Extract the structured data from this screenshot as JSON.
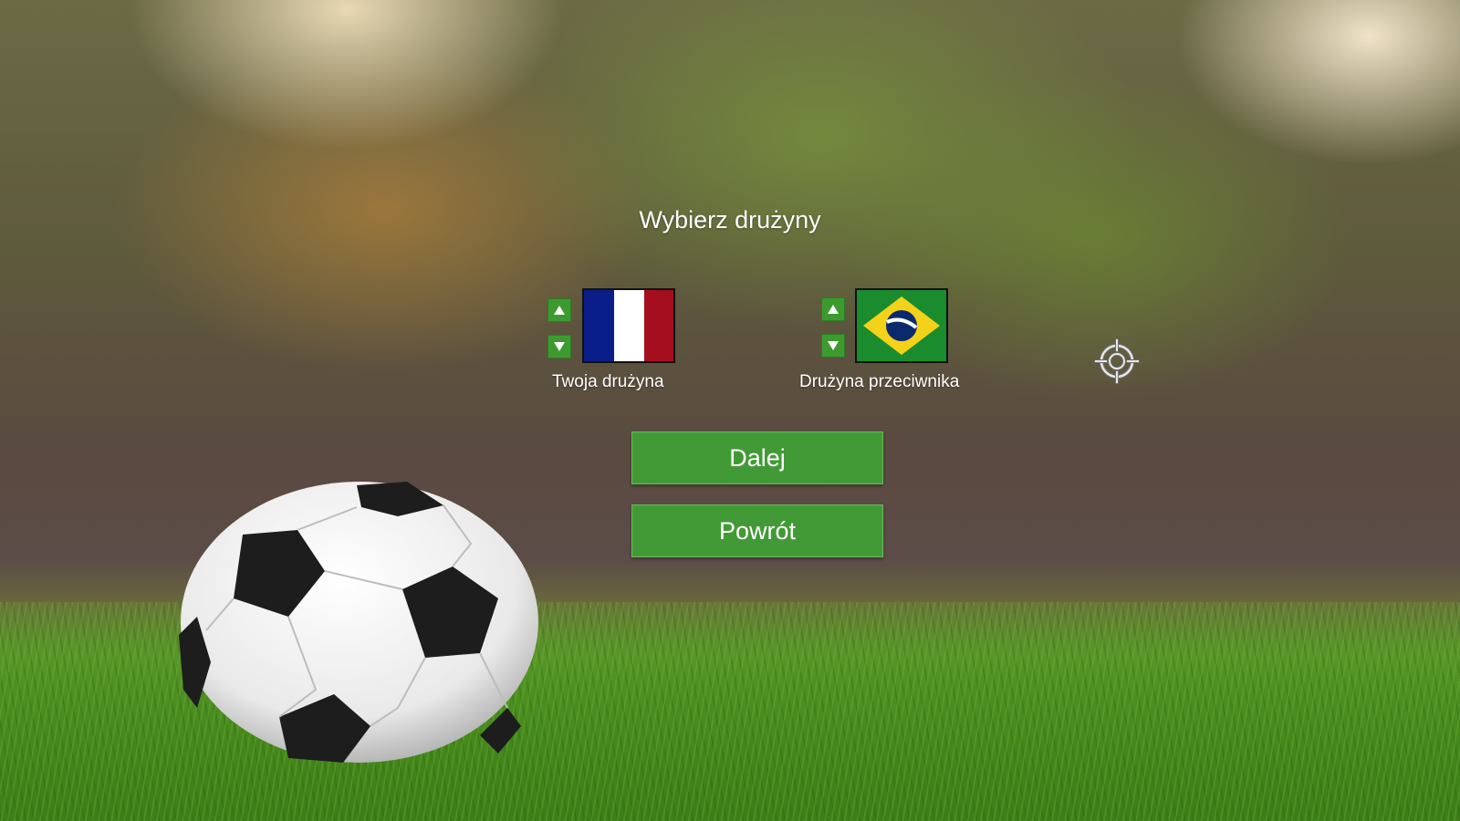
{
  "screen": {
    "title": "Wybierz drużyny"
  },
  "teams": {
    "player": {
      "label": "Twoja drużyna",
      "flag": "france-flag",
      "up_icon": "triangle-up-icon",
      "down_icon": "triangle-down-icon"
    },
    "opponent": {
      "label": "Drużyna przeciwnika",
      "flag": "brazil-flag",
      "up_icon": "triangle-up-icon",
      "down_icon": "triangle-down-icon"
    }
  },
  "buttons": {
    "next_label": "Dalej",
    "back_label": "Powrót"
  },
  "cursor": {
    "icon": "crosshair-icon"
  },
  "colors": {
    "button_green": "#429a36",
    "arrow_green": "#3d9a2f",
    "text": "#ffffff"
  }
}
